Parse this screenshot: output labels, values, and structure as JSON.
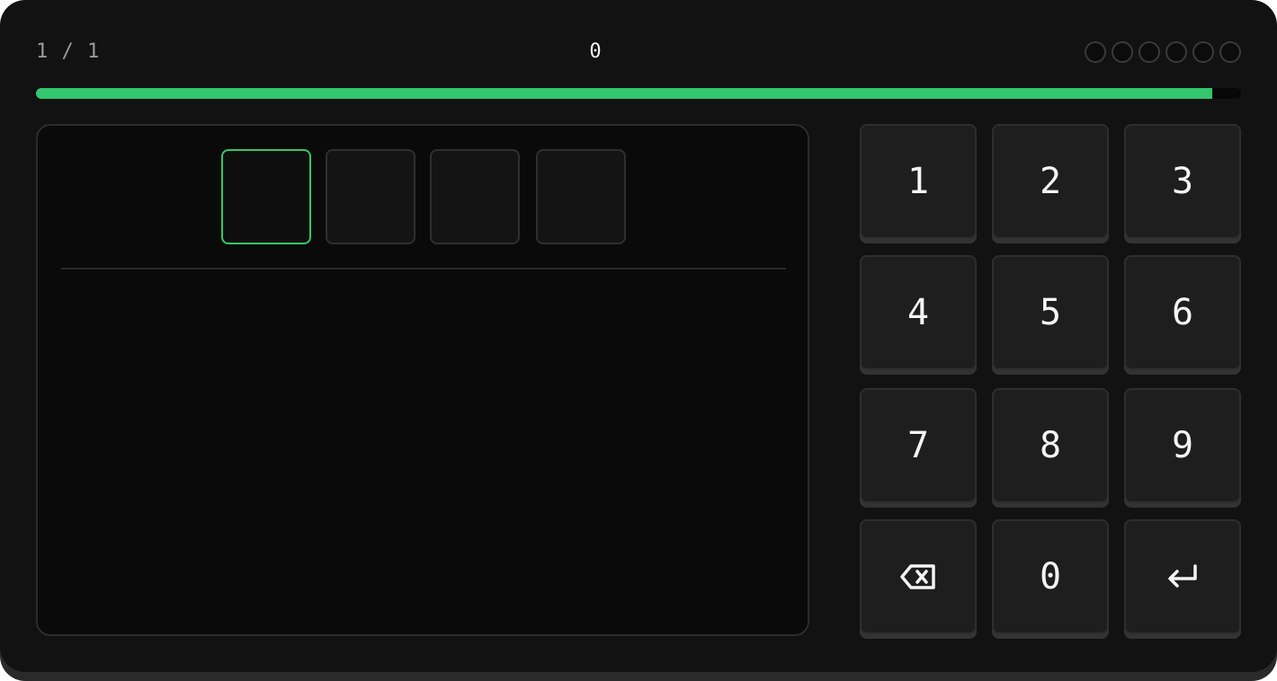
{
  "header": {
    "counter": "1 / 1",
    "score": "0",
    "lives_count": 6
  },
  "progress": {
    "fraction": 0.976,
    "color": "#33c76f"
  },
  "answer": {
    "cells": [
      "",
      "",
      "",
      ""
    ],
    "active_index": 0
  },
  "keypad": {
    "keys": [
      {
        "label": "1"
      },
      {
        "label": "2"
      },
      {
        "label": "3"
      },
      {
        "label": "4"
      },
      {
        "label": "5"
      },
      {
        "label": "6"
      },
      {
        "label": "7"
      },
      {
        "label": "8"
      },
      {
        "label": "9"
      },
      {
        "icon": "backspace-icon"
      },
      {
        "label": "0"
      },
      {
        "icon": "enter-icon"
      }
    ]
  },
  "colors": {
    "accent": "#33c76f",
    "background": "#121212",
    "key": "#1e1e1e"
  }
}
